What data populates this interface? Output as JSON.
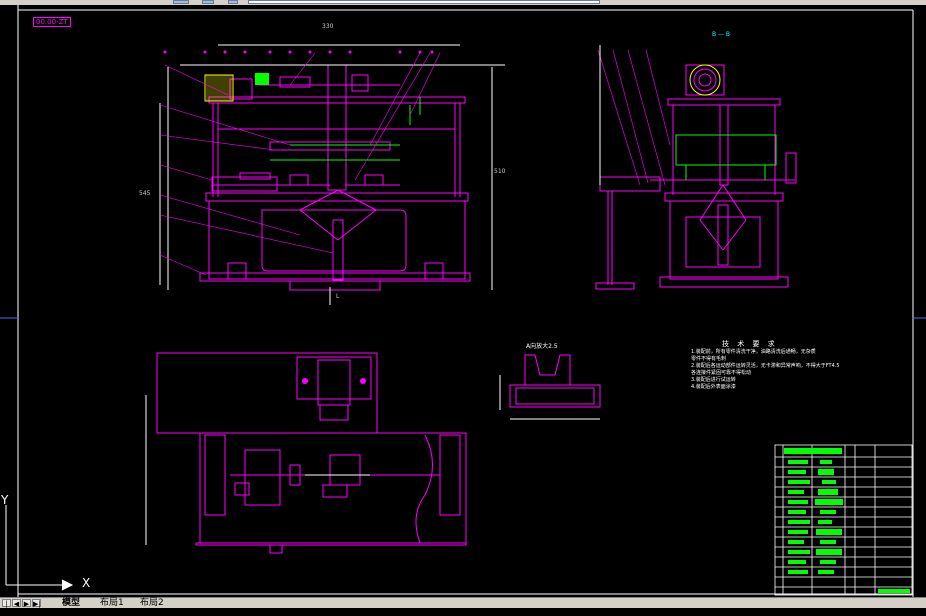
{
  "toolbar": {
    "buttons": [
      "layer-button",
      "properties-button",
      "style-button"
    ]
  },
  "drawing": {
    "sheet_label": "00.00-ZT",
    "view_label_b": "B — B",
    "section_label": "A向放大2.5",
    "dim_width": "330",
    "dim_height_left": "545",
    "dim_height_right": "510",
    "dim_bottom_label": "L"
  },
  "requirements": {
    "title": "技 术 要 求",
    "lines": [
      "1.装配前，所有零件清洗干净，油路清洗后通畅，无杂质",
      "零件不得有毛刺",
      "2.装配后各运动部件运转灵活，无卡滞和异常声响，不得大于FT4.5",
      "各连接件紧固可靠不得松动",
      "3.装配后进行试运转",
      "4.装配后外表面涂漆"
    ]
  },
  "ucs": {
    "x_label": "X",
    "y_label": "Y"
  },
  "tabs": {
    "items": [
      "模型",
      "布局1",
      "布局2"
    ],
    "active": "模型"
  },
  "colors": {
    "magenta": "#ff00ff",
    "green": "#00ff00",
    "white": "#ffffff",
    "cyan": "#00ffff",
    "yellow": "#ffff00",
    "red": "#ff0000",
    "blue": "#0000ff"
  }
}
